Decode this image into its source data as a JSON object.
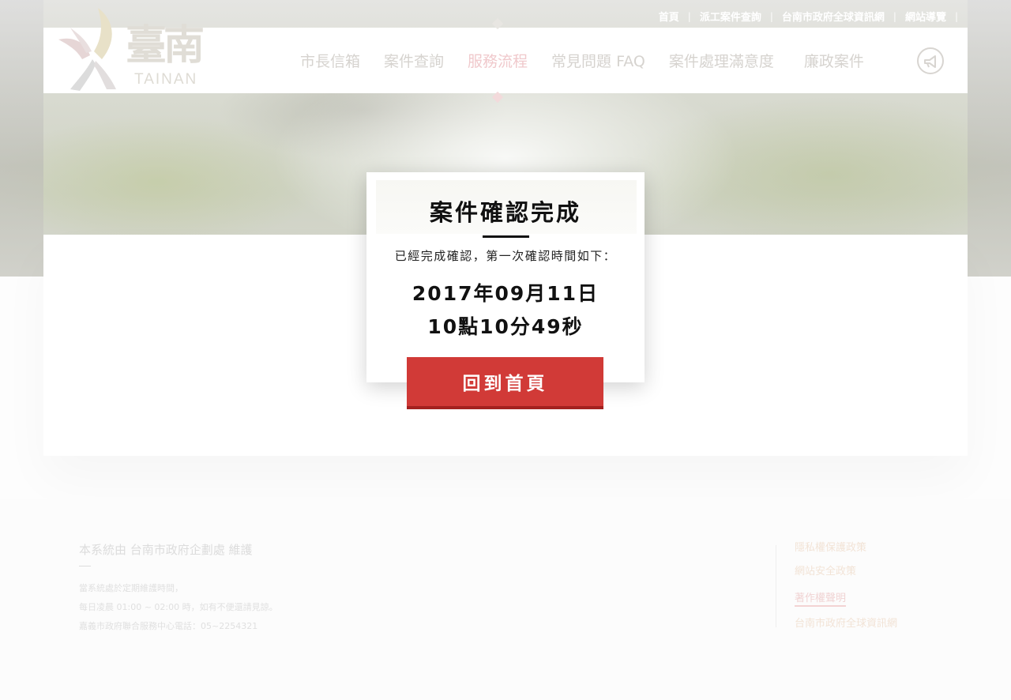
{
  "top_links": [
    "首頁",
    "派工案件查詢",
    "台南市政府全球資訊網",
    "網站導覽"
  ],
  "logo": {
    "text_main": "臺南",
    "text_en": "TAINAN"
  },
  "nav": {
    "items": [
      {
        "label": "市長信箱"
      },
      {
        "label": "案件查詢"
      },
      {
        "label": "服務流程",
        "active": true
      },
      {
        "label": "常見問題 FAQ"
      },
      {
        "label": "案件處理滿意度"
      },
      {
        "label": "廉政案件"
      }
    ],
    "icon": "megaphone-icon"
  },
  "dialog": {
    "title": "案件確認完成",
    "message": "已經完成確認，第一次確認時間如下：",
    "date": "2017年09月11日",
    "time": "10點10分49秒",
    "button_label": "回到首頁"
  },
  "footer": {
    "title": "本系統由 台南市政府企劃處 維護",
    "lines": [
      "當系統處於定期維護時間，",
      "每日凌晨 01:00 ~ 02:00 時，如有不便還請見諒。",
      "嘉義市政府聯合服務中心電話：05~2254321"
    ],
    "links": [
      {
        "label": "隱私權保護政策"
      },
      {
        "label": "網站安全政策"
      },
      {
        "label": "著作權聲明",
        "active": true
      },
      {
        "label": "台南市政府全球資訊網"
      }
    ]
  },
  "colors": {
    "accent_red": "#d13a37",
    "accent_red_dark": "#a3211f",
    "nav_active": "#f0c9cc"
  }
}
